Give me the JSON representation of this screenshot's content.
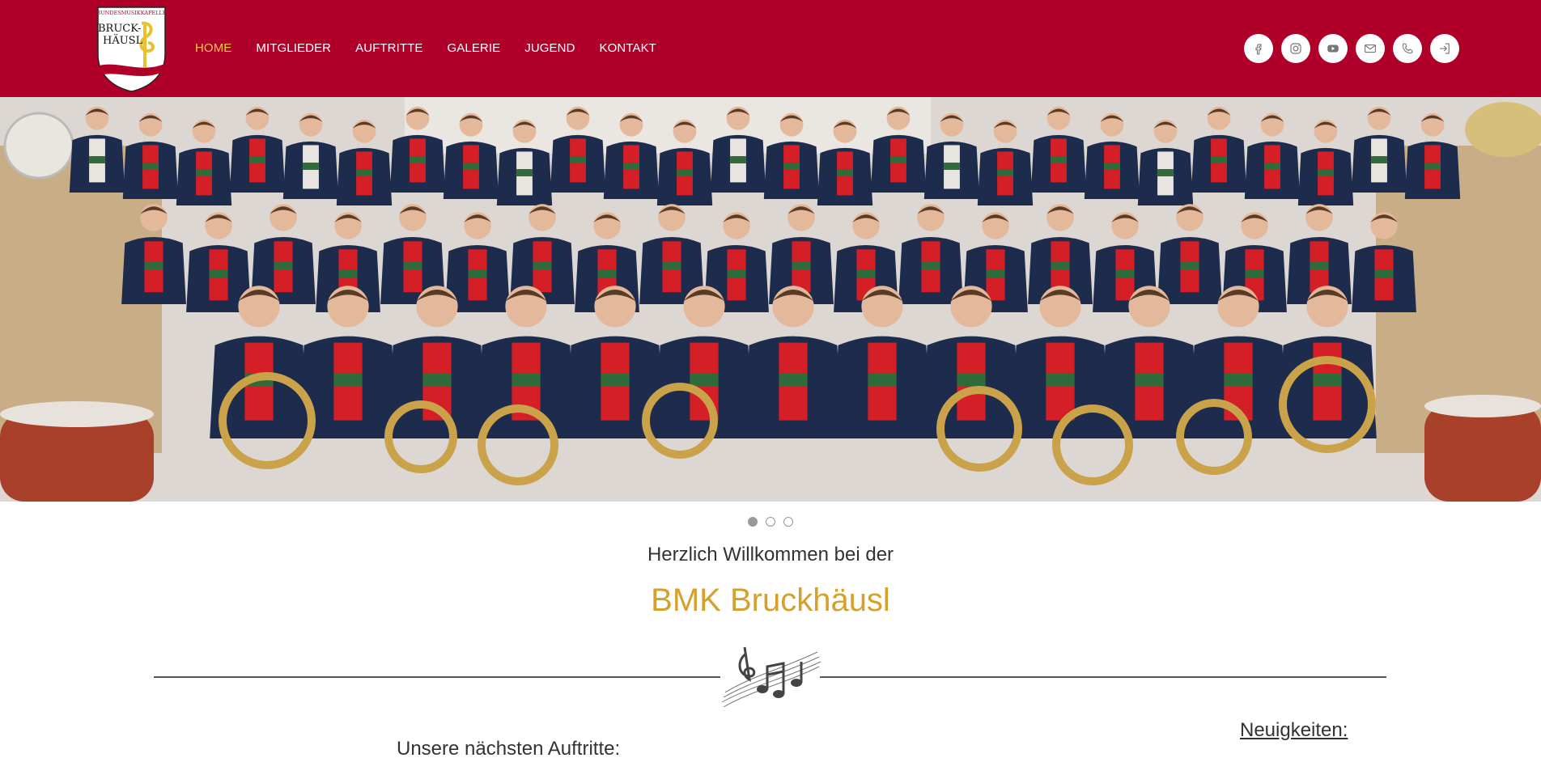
{
  "header": {
    "logo": {
      "icon": "crest-logo-icon",
      "top_text": "BUNDESMUSIKKAPELLE",
      "line1": "BRUCK-",
      "line2": "HÄUSL"
    },
    "nav": [
      {
        "label": "HOME",
        "active": true
      },
      {
        "label": "MITGLIEDER",
        "active": false
      },
      {
        "label": "AUFTRITTE",
        "active": false
      },
      {
        "label": "GALERIE",
        "active": false
      },
      {
        "label": "JUGEND",
        "active": false
      },
      {
        "label": "KONTAKT",
        "active": false
      }
    ],
    "social": [
      {
        "icon": "facebook-icon"
      },
      {
        "icon": "instagram-icon"
      },
      {
        "icon": "youtube-icon"
      },
      {
        "icon": "mail-icon"
      },
      {
        "icon": "phone-icon"
      },
      {
        "icon": "login-icon"
      }
    ]
  },
  "carousel": {
    "slides": 3,
    "active_index": 0
  },
  "welcome": {
    "line": "Herzlich Willkommen bei der",
    "band_name": "BMK Bruckhäusl"
  },
  "sections": {
    "next_events_title": "Unsere nächsten Auftritte:",
    "news_title": "Neuigkeiten:"
  },
  "colors": {
    "header_bg": "#b0002a",
    "nav_active": "#f3c74a",
    "band_name": "#d4a12a"
  }
}
